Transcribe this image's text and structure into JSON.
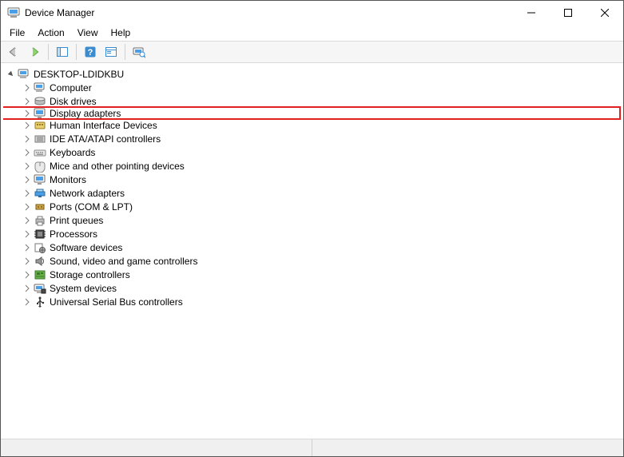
{
  "window": {
    "title": "Device Manager"
  },
  "menu": {
    "file": "File",
    "action": "Action",
    "view": "View",
    "help": "Help"
  },
  "toolbar": {
    "back": "Back",
    "forward": "Forward",
    "show_hide_console": "Show/Hide Console Tree",
    "help": "Help",
    "properties": "Properties",
    "scan": "Scan for hardware changes"
  },
  "tree": {
    "root": {
      "label": "DESKTOP-LDIDKBU",
      "expanded": true
    },
    "items": [
      {
        "label": "Computer",
        "icon": "computer"
      },
      {
        "label": "Disk drives",
        "icon": "disk"
      },
      {
        "label": "Display adapters",
        "icon": "display",
        "highlighted": true
      },
      {
        "label": "Human Interface Devices",
        "icon": "hid"
      },
      {
        "label": "IDE ATA/ATAPI controllers",
        "icon": "ide"
      },
      {
        "label": "Keyboards",
        "icon": "keyboard"
      },
      {
        "label": "Mice and other pointing devices",
        "icon": "mouse"
      },
      {
        "label": "Monitors",
        "icon": "monitor"
      },
      {
        "label": "Network adapters",
        "icon": "network"
      },
      {
        "label": "Ports (COM & LPT)",
        "icon": "port"
      },
      {
        "label": "Print queues",
        "icon": "printer"
      },
      {
        "label": "Processors",
        "icon": "cpu"
      },
      {
        "label": "Software devices",
        "icon": "software"
      },
      {
        "label": "Sound, video and game controllers",
        "icon": "sound"
      },
      {
        "label": "Storage controllers",
        "icon": "storage"
      },
      {
        "label": "System devices",
        "icon": "system"
      },
      {
        "label": "Universal Serial Bus controllers",
        "icon": "usb"
      }
    ]
  }
}
